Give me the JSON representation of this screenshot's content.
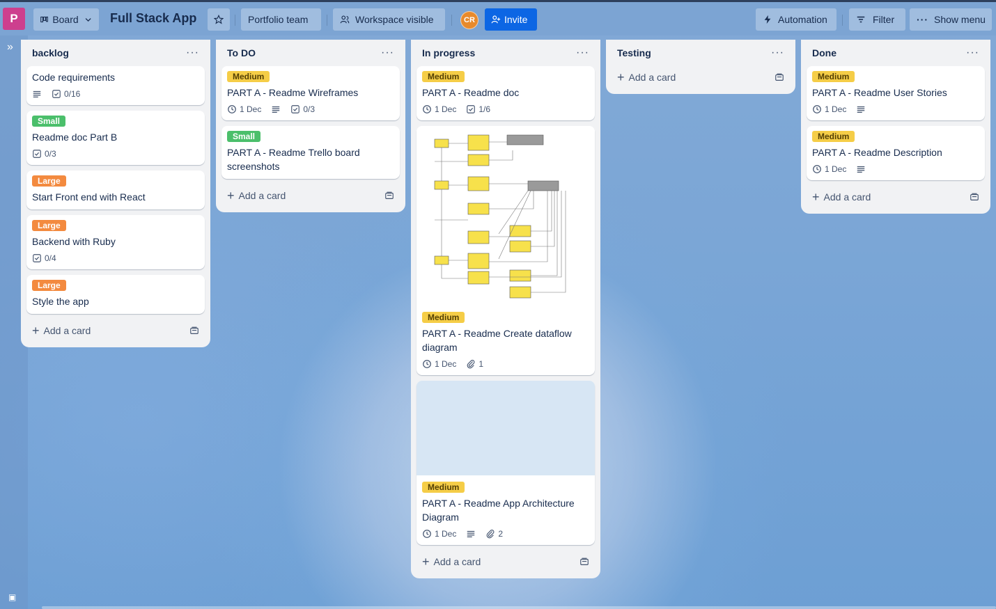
{
  "header": {
    "logo_letter": "P",
    "view_label": "Board",
    "board_title": "Full Stack App",
    "team_label": "Portfolio team",
    "visibility_label": "Workspace visible",
    "avatar_initials": "CR",
    "invite_label": "Invite",
    "automation_label": "Automation",
    "filter_label": "Filter",
    "show_menu_label": "Show menu"
  },
  "colors": {
    "label_medium": "#f5cd47",
    "label_small": "#4bbf6b",
    "label_large": "#f38a3f",
    "invite": "#0c66e4",
    "logo": "#cd3f8e"
  },
  "add_card_label": "Add a card",
  "lists": [
    {
      "title": "backlog",
      "cards": [
        {
          "title": "Code requirements",
          "checklist": "0/16"
        },
        {
          "label": "Small",
          "title": "Readme doc Part B",
          "checklist": "0/3"
        },
        {
          "label": "Large",
          "title": "Start Front end with React"
        },
        {
          "label": "Large",
          "title": "Backend with Ruby",
          "checklist": "0/4"
        },
        {
          "label": "Large",
          "title": "Style the app"
        }
      ]
    },
    {
      "title": "To DO",
      "cards": [
        {
          "label": "Medium",
          "title": "PART A - Readme Wireframes",
          "due": "1 Dec",
          "checklist": "0/3"
        },
        {
          "label": "Small",
          "title": "PART A - Readme Trello board screenshots"
        }
      ]
    },
    {
      "title": "In progress",
      "cards": [
        {
          "label": "Medium",
          "title": "PART A - Readme doc",
          "due": "1 Dec",
          "checklist": "1/6"
        },
        {
          "label": "Medium",
          "title": "PART A - Readme Create dataflow diagram",
          "due": "1 Dec",
          "attachments": "1"
        },
        {
          "label": "Medium",
          "title": "PART A - Readme App Architecture Diagram",
          "due": "1 Dec",
          "attachments": "2"
        }
      ]
    },
    {
      "title": "Testing",
      "cards": []
    },
    {
      "title": "Done",
      "cards": [
        {
          "label": "Medium",
          "title": "PART A - Readme User Stories",
          "due": "1 Dec"
        },
        {
          "label": "Medium",
          "title": "PART A - Readme Description",
          "due": "1 Dec"
        }
      ]
    }
  ]
}
